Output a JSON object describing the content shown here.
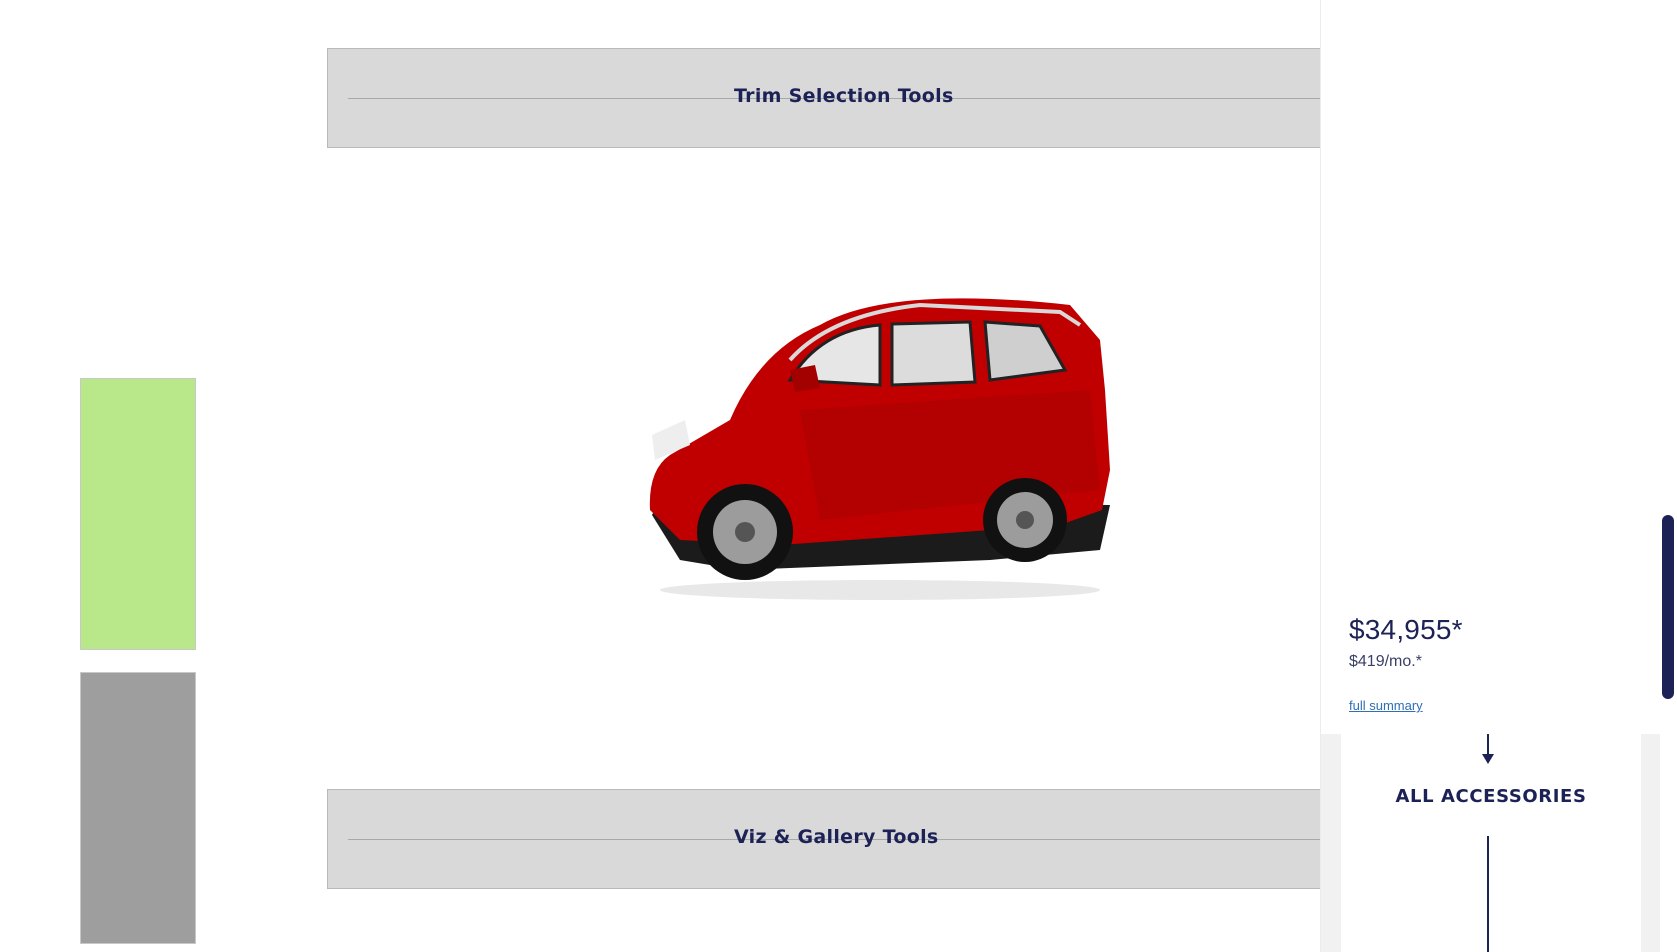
{
  "tools": {
    "trim_title": "Trim Selection Tools",
    "viz_title": "Viz & Gallery Tools"
  },
  "swatches": [
    {
      "name": "green",
      "color": "#b8e889"
    },
    {
      "name": "gray",
      "color": "#9e9e9e"
    }
  ],
  "vehicle": {
    "color": "#c00000",
    "image": "red-suv"
  },
  "summary": {
    "price": "$34,955*",
    "monthly": "$419/mo.*",
    "full_summary_link": "full summary"
  },
  "accessories": {
    "label": "ALL ACCESSORIES"
  },
  "colors": {
    "accent": "#1c2156",
    "link": "#2f6fb4"
  }
}
